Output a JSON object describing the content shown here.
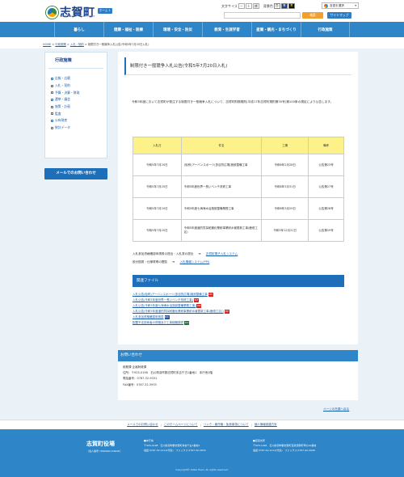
{
  "header": {
    "logo_text": "志賀町",
    "logo_sub": "SHIKA TOWN OFFICIAL WEB SITE",
    "home_badge": "ホーム 1",
    "text_size_label": "文字サイズ",
    "size_buttons": [
      "－",
      "＋",
      "標"
    ],
    "bg_color_label": "背景色",
    "color_buttons": [
      "白",
      "青",
      "黒"
    ],
    "translate_label": "言語を選択",
    "search_placeholder": "",
    "search_button": "検索",
    "sitemap_button": "サイトマップ"
  },
  "gnav": [
    "暮らし",
    "健康・福祉・医療",
    "環境・安全・防災",
    "教育・生涯学習",
    "産業・観光・まちづくり",
    "行政施策"
  ],
  "breadcrumb": {
    "home": "HOME",
    "items": [
      "行政施策",
      "入札・契約"
    ],
    "current": "制限付き一般競争入札公告(令和5年7月20日入札)",
    "separator": ">"
  },
  "sidebar": {
    "title": "行政施策",
    "items": [
      "広報・広聴",
      "入札・契約",
      "予算・決算・財政",
      "選挙・議会",
      "施策・計画",
      "監査",
      "公有財産",
      "統計データ"
    ],
    "mail_button": "メールでのお問い合わせ"
  },
  "content": {
    "title": "制限付き一般競争入札公告(令和5年7月20日入札)",
    "intro": "令和5年度において志賀町が発注する制限付き一般競争入札について、志賀町財務規則(平成17年志賀町規則第35号)第100条の規定により公告します。",
    "table": {
      "headers": [
        "入札日",
        "件名",
        "工期",
        "備考"
      ],
      "rows": [
        {
          "date": "令和5年7月20日",
          "name": "(仮称)アーバンスポーツ(多目的広場)施設整備工事",
          "period": "令和6年2月28日",
          "note": "公告第23号"
        },
        {
          "date": "令和5年7月20日",
          "name": "令和5年度世界一長いベンチ改修工事",
          "period": "令和6年3月31日",
          "note": "公告第27号"
        },
        {
          "date": "令和5年7月20日",
          "name": "令和5年度七海海水浴施設整備業務工事",
          "period": "令和6年3月29日",
          "note": "公告第28号"
        },
        {
          "date": "令和5年7月20日",
          "name": "令和5年度道的質採耐震化業耐事業耐水管更新工事(鹿垣工区)",
          "period": "令和5年12月22日",
          "note": "公告第29号"
        }
      ]
    },
    "links": [
      {
        "label": "入札参加資格確認申請書の提出・入札書の提出",
        "target": "志賀町電子入札システム"
      },
      {
        "label": "設計図書・仕様書等の閲覧",
        "target": "入札情報システム(PPI)"
      }
    ],
    "related_title": "関連ファイル",
    "files": [
      {
        "name": "入札公告(仮称)アーバンスポーツ(多目的広場)施設整備工事",
        "type": "PDF"
      },
      {
        "name": "入札公告(令和5年度世界一長いベンチ改修工事)",
        "type": "PDF"
      },
      {
        "name": "入札公告(令和5年度七海海水浴施設整備業務工事)",
        "type": "PDF"
      },
      {
        "name": "入札公告(令和5年度道的質採耐震化業耐事業耐水管更新工事(鹿垣工区))",
        "type": "PDF"
      },
      {
        "name": "入札参加資格確認申請書",
        "type": "DOC"
      },
      {
        "name": "配置予定技術者の資格及び工事経験調書",
        "type": "XLS"
      }
    ]
  },
  "contact": {
    "title": "お問い合わせ",
    "lines": [
      "総務課 企画財政課",
      "住所：〒925-0198　石川県羽咋郡志賀町末吉千古1番地1　本庁舎2階",
      "電話番号：0767-32-9331",
      "FAX番号：0767-32-3933"
    ]
  },
  "pagetop": "ページの先頭へ戻る",
  "footer_links": [
    "メールでのお問い合わせ",
    "このホームページについて",
    "リンク・著作権・免責事項について",
    "個人情報保護方針"
  ],
  "footer": {
    "name": "志賀町役場",
    "name_en": "（法人番号 7000020174645）",
    "honcho_title": "■本庁舎",
    "honcho_addr": "〒925-0198　石川県羽咋郡志賀町末吉千古1番地1",
    "honcho_tel": "電話 0767-32-1111(代表)　ファックス 0767-32-3933",
    "togi_title": "■富来支所",
    "togi_addr": "〒925-1492　石川県羽咋郡志賀町富来領家町甲の10番地",
    "togi_tel": "電話 0767-42-1111(代表)　ファックス 0767-42-2008",
    "copyright": "Copyright© Shika Town. All rights reserved."
  }
}
